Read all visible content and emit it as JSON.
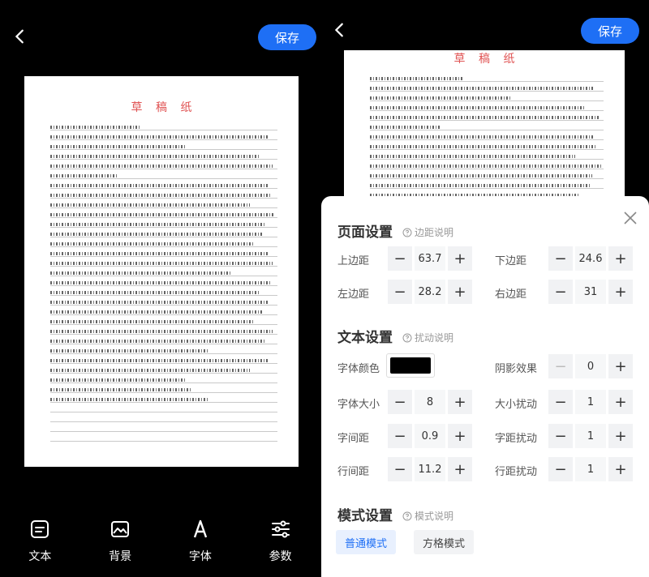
{
  "editor": {
    "save_label": "保存",
    "paper_title": "草 稿 纸"
  },
  "toolbar": {
    "items": [
      {
        "label": "文本",
        "icon": "text-icon"
      },
      {
        "label": "背景",
        "icon": "image-icon"
      },
      {
        "label": "字体",
        "icon": "font-icon"
      },
      {
        "label": "参数",
        "icon": "sliders-icon"
      }
    ]
  },
  "settings": {
    "page": {
      "title": "页面设置",
      "help": "边距说明",
      "top_label": "上边距",
      "top_value": "63.7",
      "bottom_label": "下边距",
      "bottom_value": "24.6",
      "left_label": "左边距",
      "left_value": "28.2",
      "right_label": "右边距",
      "right_value": "31"
    },
    "text": {
      "title": "文本设置",
      "help": "扰动说明",
      "color_label": "字体颜色",
      "color_value": "#000000",
      "shadow_label": "阴影效果",
      "shadow_value": "0",
      "size_label": "字体大小",
      "size_value": "8",
      "size_jitter_label": "大小扰动",
      "size_jitter_value": "1",
      "spacing_label": "字间距",
      "spacing_value": "0.9",
      "spacing_jitter_label": "字距扰动",
      "spacing_jitter_value": "1",
      "line_label": "行间距",
      "line_value": "11.2",
      "line_jitter_label": "行距扰动",
      "line_jitter_value": "1"
    },
    "mode": {
      "title": "模式设置",
      "help": "模式说明",
      "normal_label": "普通模式",
      "grid_label": "方格模式"
    }
  }
}
